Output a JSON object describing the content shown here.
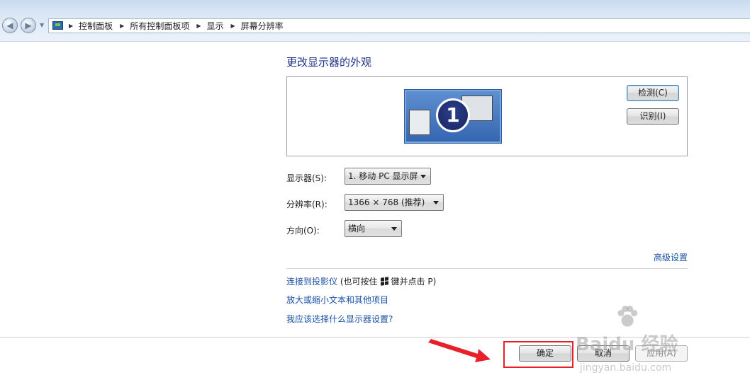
{
  "breadcrumb": [
    "控制面板",
    "所有控制面板项",
    "显示",
    "屏幕分辨率"
  ],
  "icons": {
    "back": "back-arrow-icon",
    "forward": "forward-arrow-icon",
    "address": "display-control-panel-icon",
    "windows_key": "windows-logo-icon"
  },
  "main": {
    "heading": "更改显示器的外观",
    "monitor_number": "1",
    "detect_label": "检测(C)",
    "identify_label": "识别(I)",
    "display_label": "显示器(S):",
    "display_value": "1. 移动 PC 显示屏",
    "resolution_label": "分辨率(R):",
    "resolution_value": "1366 × 768 (推荐)",
    "orientation_label": "方向(O):",
    "orientation_value": "横向",
    "advanced_link": "高级设置",
    "projector_link": "连接到投影仪",
    "projector_hint_prefix": "(也可按住",
    "projector_hint_suffix": "键并点击 P)",
    "enlarge_link": "放大或缩小文本和其他项目",
    "which_settings_link": "我应该选择什么显示器设置?"
  },
  "footer": {
    "ok_label": "确定",
    "cancel_label": "取消",
    "apply_label": "应用(A)"
  },
  "watermark": {
    "main": "Baidu 经验",
    "sub": "jingyan.baidu.com"
  },
  "colors": {
    "link": "#1a4fa3",
    "heading": "#1e3287",
    "highlight": "#e8202a"
  }
}
